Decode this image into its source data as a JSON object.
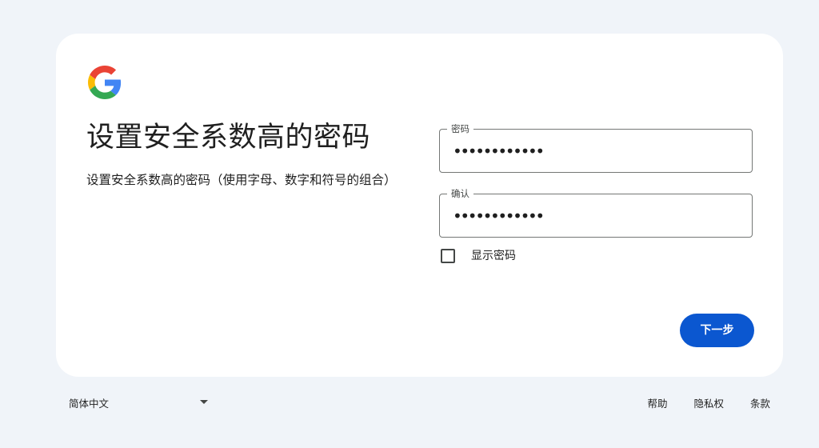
{
  "header": {
    "logo_icon": "google-g-logo-icon",
    "title": "设置安全系数高的密码",
    "subtitle": "设置安全系数高的密码（使用字母、数字和符号的组合）"
  },
  "form": {
    "password": {
      "label": "密码",
      "value": "••••••••••••"
    },
    "confirm": {
      "label": "确认",
      "value": "••••••••••••"
    },
    "show_password": {
      "label": "显示密码",
      "checked": false
    },
    "next_button": "下一步"
  },
  "footer": {
    "language": "简体中文",
    "language_icon": "caret-down-icon",
    "links": [
      "帮助",
      "隐私权",
      "条款"
    ]
  },
  "colors": {
    "page_background": "#f0f4f9",
    "card_background": "#ffffff",
    "primary_button": "#0b57d0",
    "google_blue": "#4285F4",
    "google_red": "#EA4335",
    "google_yellow": "#FBBC05",
    "google_green": "#34A853"
  }
}
